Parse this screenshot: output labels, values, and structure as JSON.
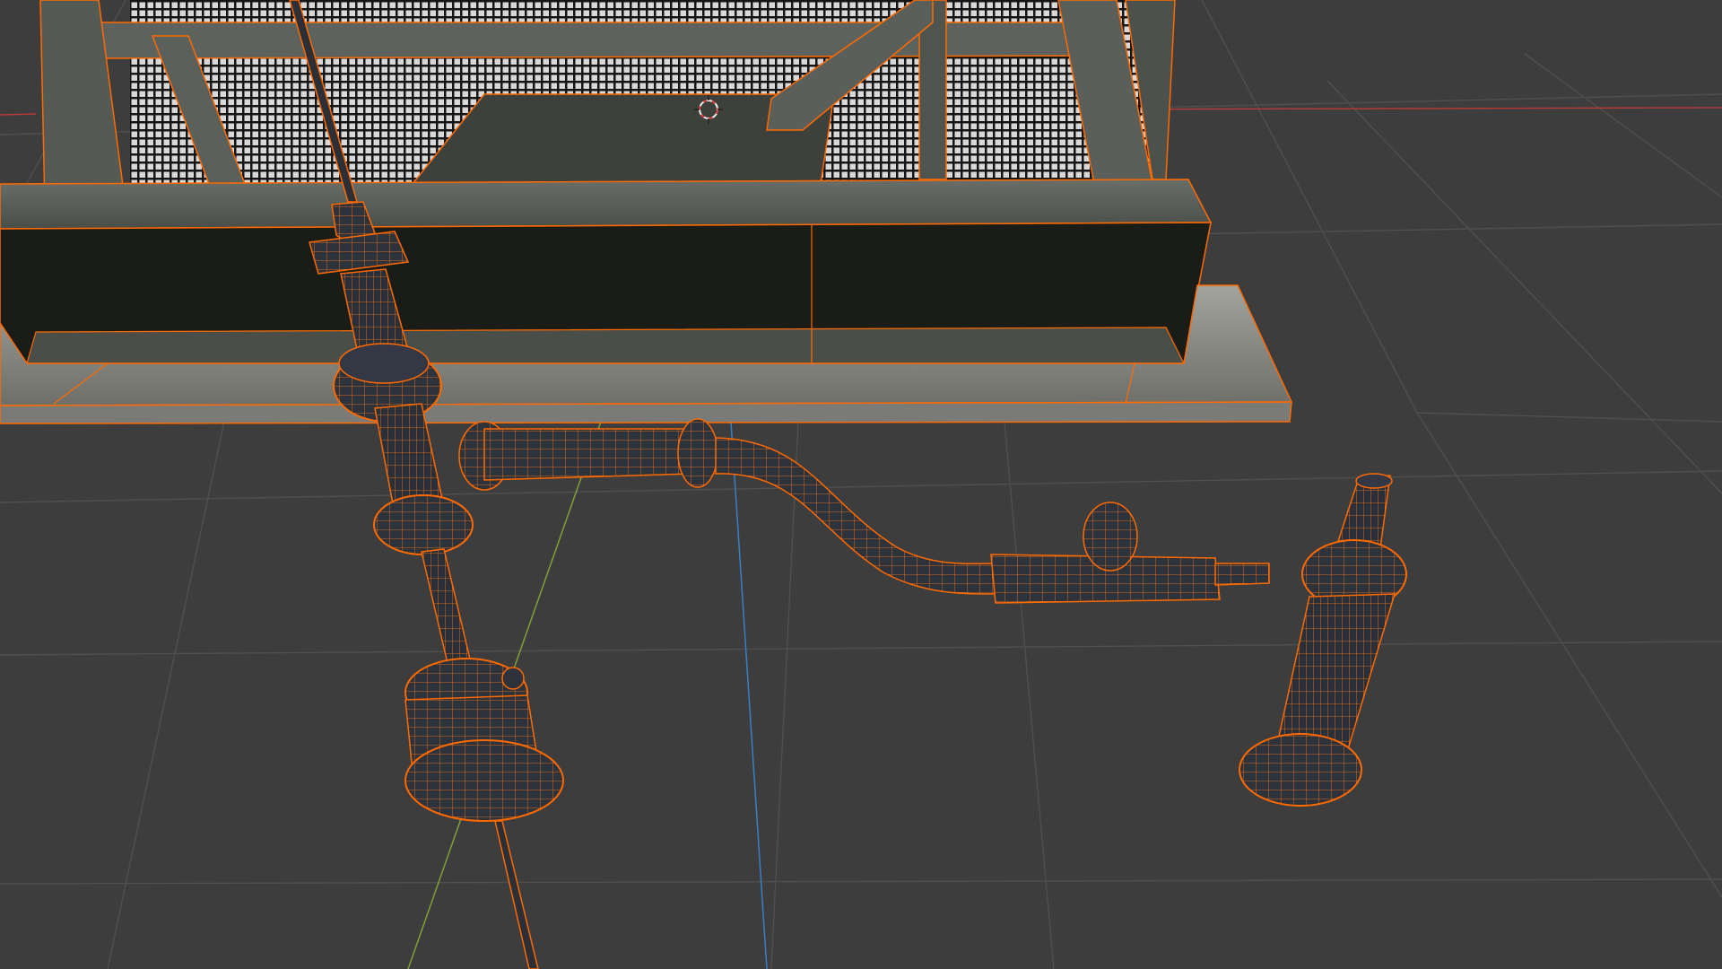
{
  "viewport": {
    "background": "#3d3d3d",
    "grid_color": "#4c4c4c",
    "axis_x_color": "#b33a3a",
    "axis_y_color": "#7fa13a",
    "axis_z_color": "#3a7fc4",
    "selection_outline_color": "#ff6a00",
    "wireframe_color": "#ff7a1a",
    "metal_color": "#2c3036",
    "concrete_color": "#8a8a86",
    "steel_color": "#5a5e58",
    "grating_color": "#1c1c1c"
  },
  "scene": {
    "objects": [
      "pumpjack-frame",
      "concrete-pad",
      "wellhead-pipe-assembly",
      "flowline",
      "check-valve",
      "vent-stack"
    ],
    "cursor_icon": "3d-cursor-icon",
    "selection_state": "all-selected-wireframe-overlay"
  }
}
